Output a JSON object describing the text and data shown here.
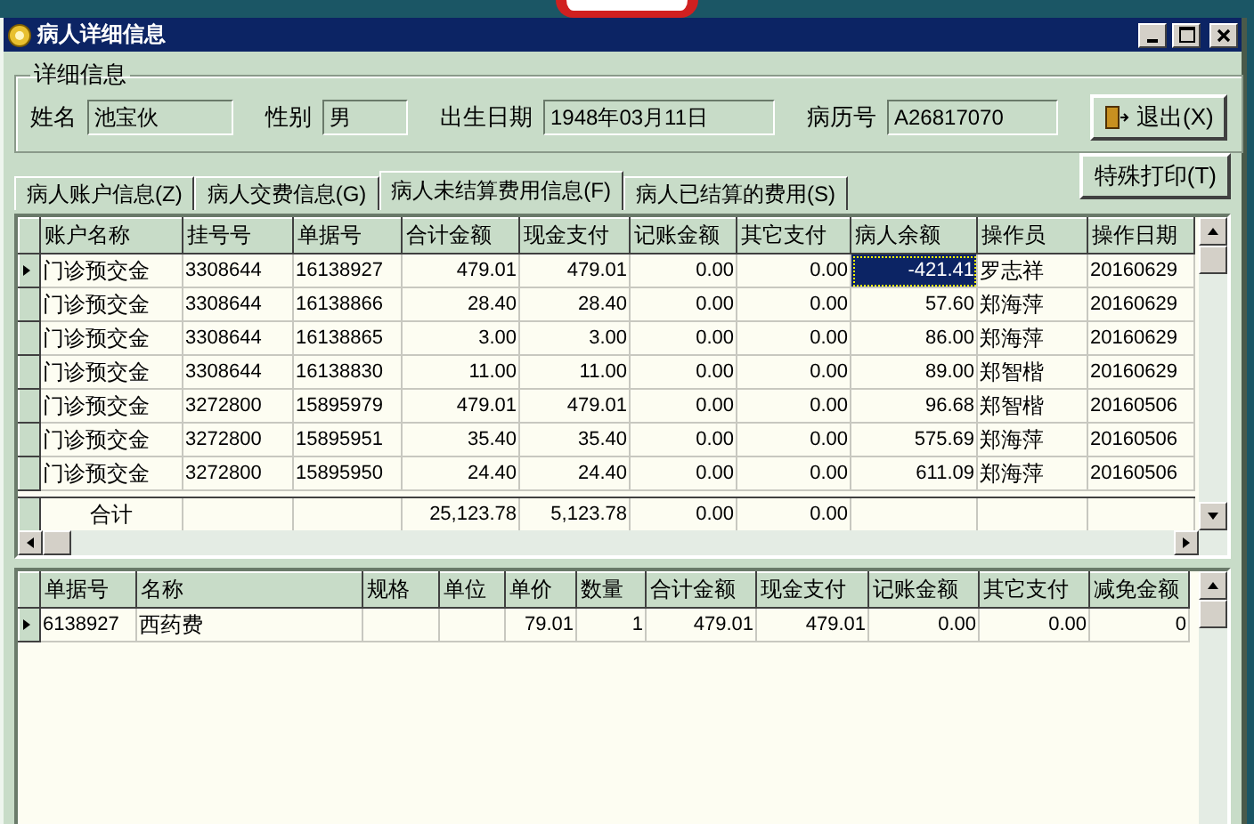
{
  "window": {
    "title": "病人详细信息"
  },
  "details": {
    "legend": "详细信息",
    "fields": [
      {
        "label": "姓名",
        "value": "池宝伙"
      },
      {
        "label": "性别",
        "value": "男"
      },
      {
        "label": "出生日期",
        "value": "1948年03月11日"
      },
      {
        "label": "病历号",
        "value": "A26817070"
      }
    ],
    "exit_button": "退出(X)"
  },
  "tabs": [
    {
      "label": "病人账户信息(Z)",
      "selected": false
    },
    {
      "label": "病人交费信息(G)",
      "selected": false
    },
    {
      "label": "病人未结算费用信息(F)",
      "selected": true
    },
    {
      "label": "病人已结算的费用(S)",
      "selected": false
    }
  ],
  "print_button": "特殊打印(T)",
  "fee_table": {
    "columns": [
      "账户名称",
      "挂号号",
      "单据号",
      "合计金额",
      "现金支付",
      "记账金额",
      "其它支付",
      "病人余额",
      "操作员",
      "操作日期"
    ],
    "rows": [
      {
        "selected": true,
        "balance_focused": true,
        "cells": [
          "门诊预交金",
          "3308644",
          "16138927",
          "479.01",
          "479.01",
          "0.00",
          "0.00",
          "-421.41",
          "罗志祥",
          "20160629"
        ]
      },
      {
        "selected": false,
        "balance_focused": false,
        "cells": [
          "门诊预交金",
          "3308644",
          "16138866",
          "28.40",
          "28.40",
          "0.00",
          "0.00",
          "57.60",
          "郑海萍",
          "20160629"
        ]
      },
      {
        "selected": false,
        "balance_focused": false,
        "cells": [
          "门诊预交金",
          "3308644",
          "16138865",
          "3.00",
          "3.00",
          "0.00",
          "0.00",
          "86.00",
          "郑海萍",
          "20160629"
        ]
      },
      {
        "selected": false,
        "balance_focused": false,
        "cells": [
          "门诊预交金",
          "3308644",
          "16138830",
          "11.00",
          "11.00",
          "0.00",
          "0.00",
          "89.00",
          "郑智楷",
          "20160629"
        ]
      },
      {
        "selected": false,
        "balance_focused": false,
        "cells": [
          "门诊预交金",
          "3272800",
          "15895979",
          "479.01",
          "479.01",
          "0.00",
          "0.00",
          "96.68",
          "郑智楷",
          "20160506"
        ]
      },
      {
        "selected": false,
        "balance_focused": false,
        "cells": [
          "门诊预交金",
          "3272800",
          "15895951",
          "35.40",
          "35.40",
          "0.00",
          "0.00",
          "575.69",
          "郑海萍",
          "20160506"
        ]
      },
      {
        "selected": false,
        "balance_focused": false,
        "cells": [
          "门诊预交金",
          "3272800",
          "15895950",
          "24.40",
          "24.40",
          "0.00",
          "0.00",
          "611.09",
          "郑海萍",
          "20160506"
        ]
      }
    ],
    "total": {
      "label": "合计",
      "total_amount": "25,123.78",
      "cash": "5,123.78",
      "billed": "0.00",
      "other": "0.00"
    }
  },
  "detail_table": {
    "columns": [
      "单据号",
      "名称",
      "规格",
      "单位",
      "单价",
      "数量",
      "合计金额",
      "现金支付",
      "记账金额",
      "其它支付",
      "减免金额"
    ],
    "rows": [
      {
        "selected": true,
        "cells": [
          "6138927",
          "西药费",
          null,
          null,
          "79.01",
          "1",
          "479.01",
          "479.01",
          "0.00",
          "0.00",
          "0"
        ]
      }
    ]
  }
}
